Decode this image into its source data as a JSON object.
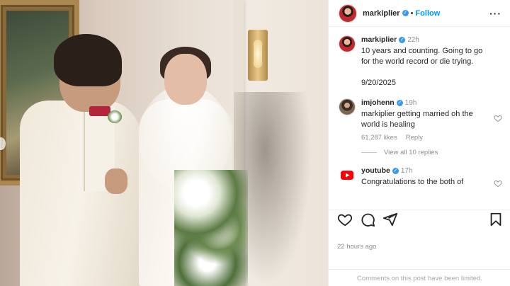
{
  "post": {
    "author": "markiplier",
    "follow_label": "Follow",
    "caption": {
      "username": "markiplier",
      "time": "22h",
      "text": "10 years and counting. Going to go for the world record or die trying.",
      "date": "9/20/2025"
    },
    "comments": [
      {
        "username": "imjohenn",
        "time": "19h",
        "text": "markiplier getting married oh the world is healing",
        "likes": "61,287 likes",
        "reply_label": "Reply",
        "view_replies": "View all 10 replies"
      },
      {
        "username": "youtube",
        "time": "17h",
        "text": "Congratulations to the both of"
      }
    ],
    "posted_ago": "22 hours ago",
    "comments_limited": "Comments on this post have been limited."
  },
  "colors": {
    "accent": "#0095f6",
    "verified": "#3897f0",
    "muted": "#8e8e8e"
  },
  "icons": [
    "more-icon",
    "heart-icon",
    "comment-icon",
    "share-icon",
    "save-icon",
    "verified-icon",
    "youtube-icon"
  ]
}
